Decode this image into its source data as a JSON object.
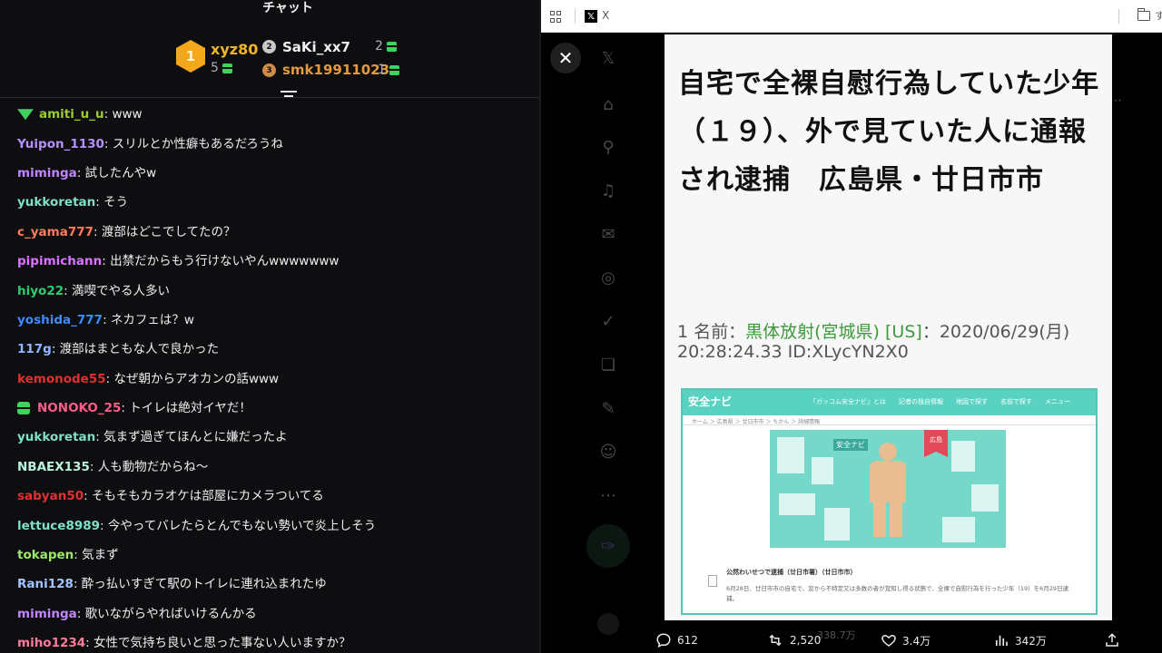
{
  "chat": {
    "title": "チャット",
    "top_gifters": [
      {
        "rank": "1",
        "name": "xyz80",
        "count": "5"
      },
      {
        "rank": "2",
        "name": "SaKi_xx7",
        "count": "2"
      },
      {
        "rank": "3",
        "name": "smk19911023",
        "count": "1"
      }
    ],
    "messages": [
      {
        "user": "amiti_u_u",
        "text": ": www",
        "color": "#9acd32"
      },
      {
        "user": "Yuipon_1130",
        "text": ": スリルとか性癖もあるだろうね",
        "color": "#b690ff"
      },
      {
        "user": "miminga",
        "text": ": 試したんやw",
        "color": "#c084fc"
      },
      {
        "user": "yukkoretan",
        "text": ": そう",
        "color": "#7ee0c8"
      },
      {
        "user": "c_yama777",
        "text": ": 渡部はどこでしてたの？",
        "color": "#ff7b5c"
      },
      {
        "user": "pipimichann",
        "text": ": 出禁だからもう行けないやんwwwwwww",
        "color": "#d874ff"
      },
      {
        "user": "hiyo22",
        "text": ": 満喫でやる人多い",
        "color": "#2ecc71"
      },
      {
        "user": "yoshida_777",
        "text": ": ネカフェは？w",
        "color": "#3d8bff"
      },
      {
        "user": "117g",
        "text": ": 渡部はまともな人で良かった",
        "color": "#8fb6ff"
      },
      {
        "user": "kemonode55",
        "text": ": なぜ朝からアオカンの話www",
        "color": "#e03131"
      },
      {
        "user": "NONOKO_25",
        "text": ": トイレは絶対イヤだ！",
        "color": "#ff5c8a"
      },
      {
        "user": "yukkoretan",
        "text": ": 気まず過ぎてほんとに嫌だったよ",
        "color": "#7ee0c8"
      },
      {
        "user": "NBAEX135",
        "text": ": 人も動物だからね〜",
        "color": "#b7f5e0"
      },
      {
        "user": "sabyan50",
        "text": ": そもそもカラオケは部屋にカメラついてる",
        "color": "#e03131"
      },
      {
        "user": "lettuce8989",
        "text": ": 今やってバレたらとんでもない勢いで炎上しそう",
        "color": "#7ee0c8"
      },
      {
        "user": "tokapen",
        "text": ": 気まず",
        "color": "#9be86a"
      },
      {
        "user": "Rani128",
        "text": ": 酔っ払いすぎて駅のトイレに連れ込まれたゆ",
        "color": "#a3c4ff"
      },
      {
        "user": "miminga",
        "text": ": 歌いながらやればいけるんかる",
        "color": "#c084fc"
      },
      {
        "user": "miho1234",
        "text": ": 女性で気持ち良いと思った事ない人いますか？",
        "color": "#ff7b9c"
      }
    ]
  },
  "browser": {
    "tab_title": "X",
    "tab_edge_text": "す",
    "card": {
      "headline": "自宅で全裸自慰行為していた少年（１９）、外で見ていた人に通報され逮捕　広島県・廿日市市",
      "meta_prefix": "1 名前：",
      "meta_name": "黒体放射(宮城県) [US]",
      "meta_suffix": "：2020/06/29(月) 20:28:24.33 ID:XLycYN2X0",
      "embedded": {
        "logo": "安全ナビ",
        "menu": "「ガッコム安全ナビ」とは　　記者の独自情報　　地図で探す　　名前で探す　　メニュー",
        "breadcrumb": "ホーム ＞ 広島県 ＞ 廿日市市 ＞ ちかん ＞ 詳細情報",
        "flag": "広島",
        "heading": "公然わいせつで逮捕（廿日市署）（廿日市市）",
        "body": "6月28日、廿日市市の自宅で、窓から不特定又は多数の者が覚知し得る状態で、全裸で自慰行為を行った少年（19）を6月29日逮捕。"
      }
    },
    "actions": {
      "reply": "612",
      "retweet": "2,520",
      "like": "3.4万",
      "views": "342万"
    },
    "ghost_count": "338.7万"
  }
}
